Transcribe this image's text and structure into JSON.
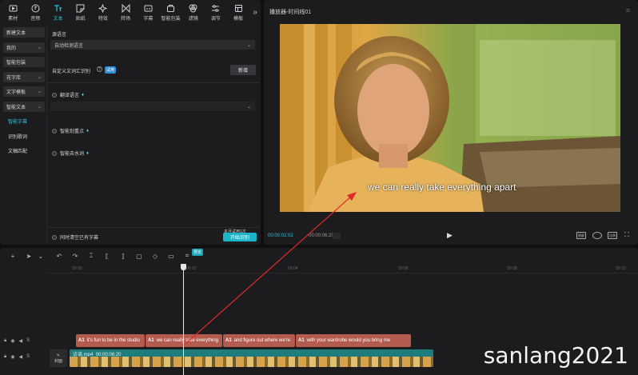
{
  "toolbar": {
    "tools": [
      {
        "label": "素材",
        "icon": "media-icon"
      },
      {
        "label": "音频",
        "icon": "audio-icon"
      },
      {
        "label": "文本",
        "icon": "text-icon",
        "active": true
      },
      {
        "label": "贴纸",
        "icon": "sticker-icon"
      },
      {
        "label": "特效",
        "icon": "effects-icon"
      },
      {
        "label": "转场",
        "icon": "transition-icon"
      },
      {
        "label": "字幕",
        "icon": "caption-icon"
      },
      {
        "label": "智能包装",
        "icon": "smart-pack-icon"
      },
      {
        "label": "滤镜",
        "icon": "filter-icon"
      },
      {
        "label": "调节",
        "icon": "adjust-icon"
      },
      {
        "label": "模板",
        "icon": "template-icon"
      }
    ],
    "more": "»"
  },
  "side_menu": {
    "items": [
      "新建文本",
      "我的",
      "智能包装",
      "花字库",
      "文字模板",
      "智能文本"
    ],
    "sub_items": [
      "智能字幕",
      "识别歌词",
      "文稿匹配"
    ]
  },
  "captions_panel": {
    "source_lang_label": "源语言",
    "source_lang_value": "自动检测语言",
    "custom_vocab_label": "自定义文词汇识别",
    "trial_badge": "试用",
    "new_button": "新增",
    "translate_label": "翻译语言",
    "smart_break_label": "智能划重点",
    "remove_filler_label": "智能去水词",
    "clear_existing_label": "同时清空已有字幕",
    "start_button_hint": "本月试用1次",
    "start_button": "开始识别"
  },
  "player": {
    "title": "播放器-时间线01",
    "subtitle": "we can really take everything apart",
    "current_time": "00:00:02:02",
    "total_time": "00:00:06:20",
    "btn_full": "原屏",
    "btn_ratio": "比例"
  },
  "timeline": {
    "ruler_ticks": [
      "00:00",
      "00:02",
      "00:04",
      "00:06",
      "00:08",
      "00:10"
    ],
    "preview_badge": "预览",
    "cover_label": "封面",
    "video_clip": {
      "name": "访谈.mp4",
      "duration": "00:00:06:20"
    },
    "caption_clips": [
      "it's fun to be in the studio",
      "we can really take everything",
      "and figure out where we're",
      "with your wardrobe would you bring me"
    ],
    "caption_clip_tag": "A1"
  },
  "watermark": "sanlang2021",
  "colors": {
    "accent": "#27c3d6",
    "caption_clip": "#b35b4f",
    "video_clip": "#1e7c7c",
    "arrow": "#e02a2a"
  }
}
